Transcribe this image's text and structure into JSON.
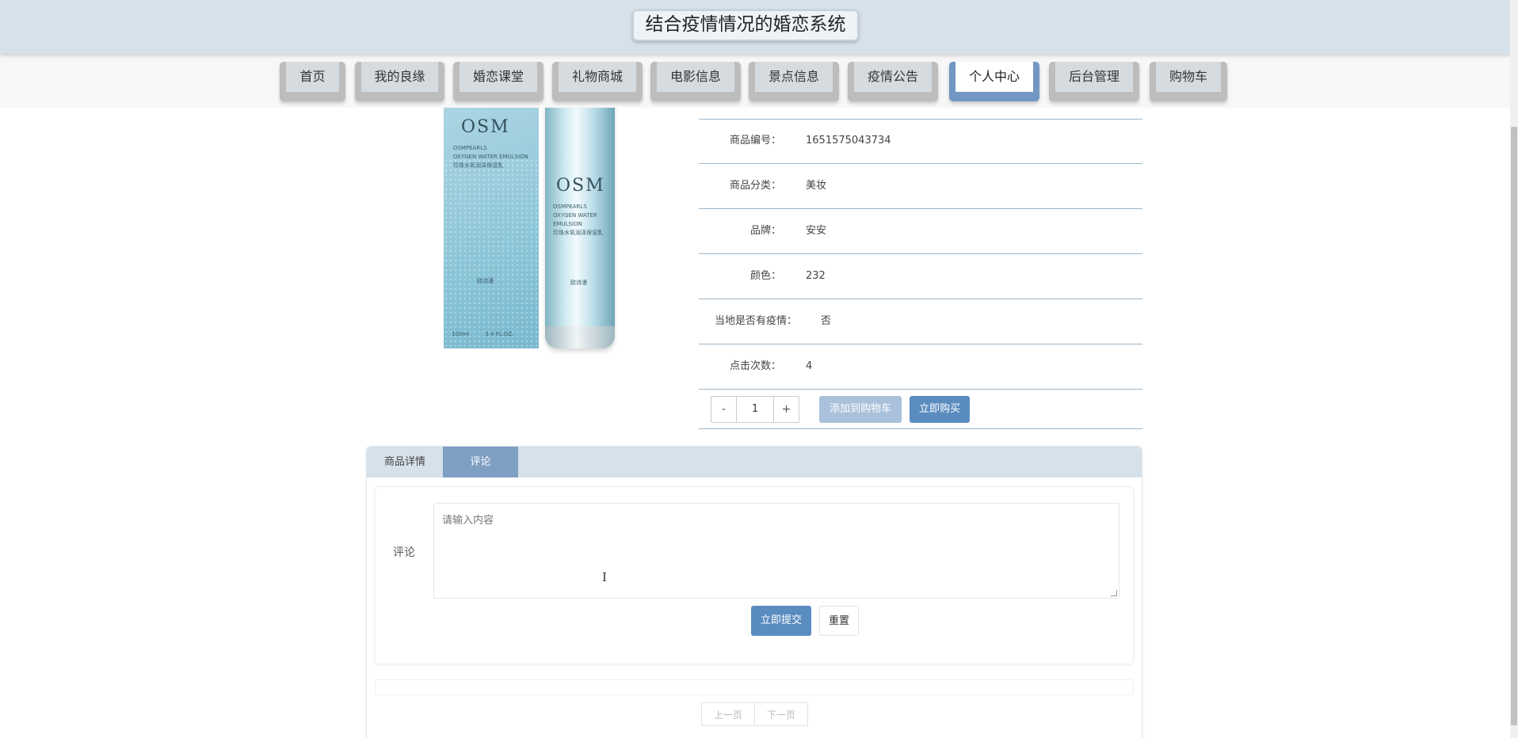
{
  "header": {
    "title": "结合疫情情况的婚恋系统"
  },
  "nav": {
    "items": [
      {
        "label": "首页"
      },
      {
        "label": "我的良缘"
      },
      {
        "label": "婚恋课堂"
      },
      {
        "label": "礼物商城"
      },
      {
        "label": "电影信息"
      },
      {
        "label": "景点信息"
      },
      {
        "label": "疫情公告"
      },
      {
        "label": "个人中心",
        "active": true
      },
      {
        "label": "后台管理"
      },
      {
        "label": "购物车"
      }
    ]
  },
  "product": {
    "image_text": {
      "brand_mark": "OSM",
      "line1": "OSMPEARLS",
      "line2": "OXYGEN WATER EMULSION",
      "line3": "珍珠水氧润泽保湿乳",
      "seal": "欧诗漫",
      "volume": "100ml",
      "volume_oz": "3.4 FL.OZ."
    },
    "fields": [
      {
        "label": "商品编号：",
        "value": "1651575043734"
      },
      {
        "label": "商品分类：",
        "value": "美妆"
      },
      {
        "label": "品牌：",
        "value": "安安"
      },
      {
        "label": "颜色：",
        "value": "232"
      },
      {
        "label": "当地是否有疫情：",
        "value": "否"
      },
      {
        "label": "点击次数：",
        "value": "4"
      }
    ],
    "quantity": {
      "minus": "-",
      "value": "1",
      "plus": "+"
    },
    "add_to_cart_label": "添加到购物车",
    "buy_now_label": "立即购买"
  },
  "tabs": {
    "items": [
      {
        "label": "商品详情"
      },
      {
        "label": "评论",
        "active": true
      }
    ]
  },
  "comment": {
    "label": "评论",
    "placeholder": "请输入内容",
    "value": "",
    "submit_label": "立即提交",
    "reset_label": "重置"
  },
  "pagination": {
    "prev_label": "上一页",
    "next_label": "下一页"
  },
  "colors": {
    "header_bg": "#d6e1ea",
    "accent": "#5b8cc0",
    "active_tab": "#7f9fc3",
    "disabled_button": "#a9c1da",
    "table_line": "#9eb6c8"
  }
}
